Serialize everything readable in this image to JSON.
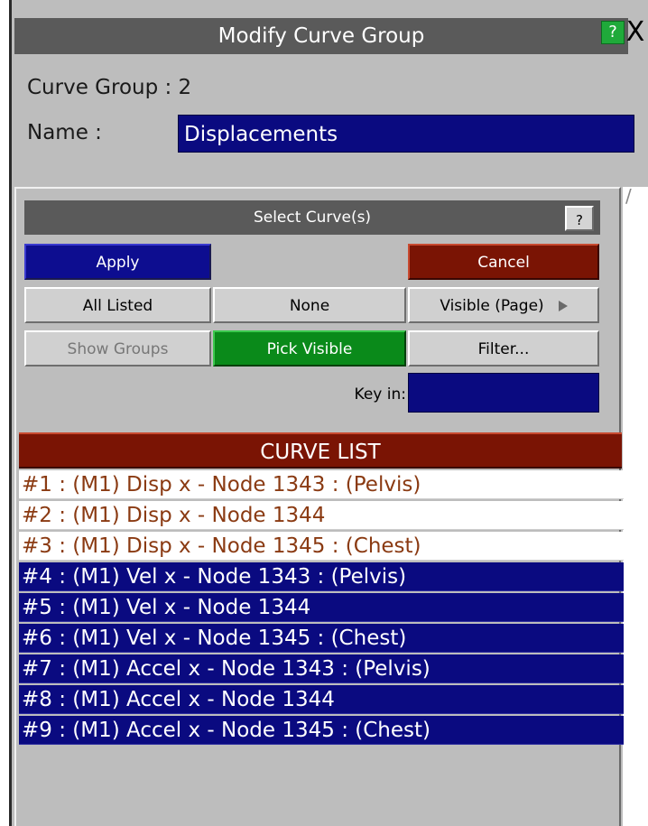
{
  "window": {
    "title": "Modify Curve Group",
    "help_label": "?",
    "close_label": "X"
  },
  "group": {
    "curve_group_text": "Curve Group : 2",
    "name_label": "Name :",
    "name_value": "Displacements"
  },
  "select": {
    "title": "Select Curve(s)",
    "help_label": "?",
    "buttons": {
      "apply": "Apply",
      "cancel": "Cancel",
      "all_listed": "All Listed",
      "none": "None",
      "visible_page": "Visible (Page)",
      "show_groups": "Show Groups",
      "pick_visible": "Pick Visible",
      "filter": "Filter..."
    },
    "key_in_label": "Key in:",
    "key_in_value": ""
  },
  "curve_list": {
    "header": "CURVE LIST",
    "items": [
      {
        "label": "#1 : (M1) Disp x - Node 1343 : (Pelvis)",
        "selected": false
      },
      {
        "label": "#2 : (M1) Disp x - Node 1344",
        "selected": false
      },
      {
        "label": "#3 : (M1) Disp x - Node 1345 : (Chest)",
        "selected": false
      },
      {
        "label": "#4 : (M1) Vel x - Node 1343 : (Pelvis)",
        "selected": true
      },
      {
        "label": "#5 : (M1) Vel x - Node 1344",
        "selected": true
      },
      {
        "label": "#6 : (M1) Vel x - Node 1345 : (Chest)",
        "selected": true
      },
      {
        "label": "#7 : (M1) Accel x - Node 1343 : (Pelvis)",
        "selected": true
      },
      {
        "label": "#8 : (M1) Accel x - Node 1344",
        "selected": true
      },
      {
        "label": "#9 : (M1) Accel x - Node 1345 : (Chest)",
        "selected": true
      }
    ]
  },
  "colors": {
    "selected_row": "#0a0a80",
    "unselected_row_text": "#8a3a12",
    "title_bar": "#5a5a5a",
    "cancel": "#7a1404",
    "pick_visible": "#0a8a1a"
  }
}
